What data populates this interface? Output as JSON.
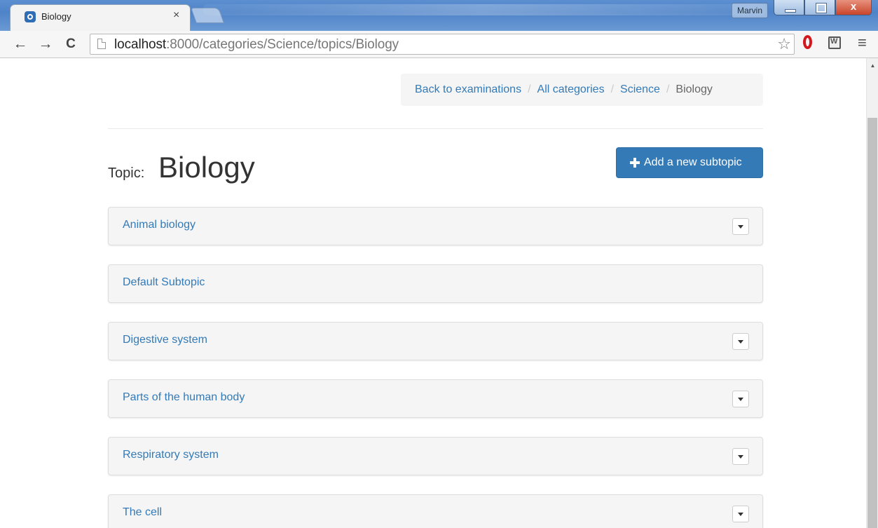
{
  "browser": {
    "tab_title": "Biology",
    "tab_close": "×",
    "user": "Marvin",
    "url_host": "localhost",
    "url_path": ":8000/categories/Science/topics/Biology",
    "window_close": "x"
  },
  "breadcrumb": {
    "items": [
      "Back to examinations",
      "All categories",
      "Science"
    ],
    "active": "Biology",
    "separator": "/"
  },
  "topic": {
    "label": "Topic:",
    "name": "Biology"
  },
  "add_button": {
    "label": "Add a new subtopic",
    "icon": "plus-icon"
  },
  "subtopics": [
    {
      "title": "Animal biology",
      "has_dropdown": true
    },
    {
      "title": "Default Subtopic",
      "has_dropdown": false
    },
    {
      "title": "Digestive system",
      "has_dropdown": true
    },
    {
      "title": "Parts of the human body",
      "has_dropdown": true
    },
    {
      "title": "Respiratory system",
      "has_dropdown": true
    },
    {
      "title": "The cell",
      "has_dropdown": true
    }
  ],
  "colors": {
    "primary": "#337ab7",
    "panel_bg": "#f5f5f5"
  }
}
